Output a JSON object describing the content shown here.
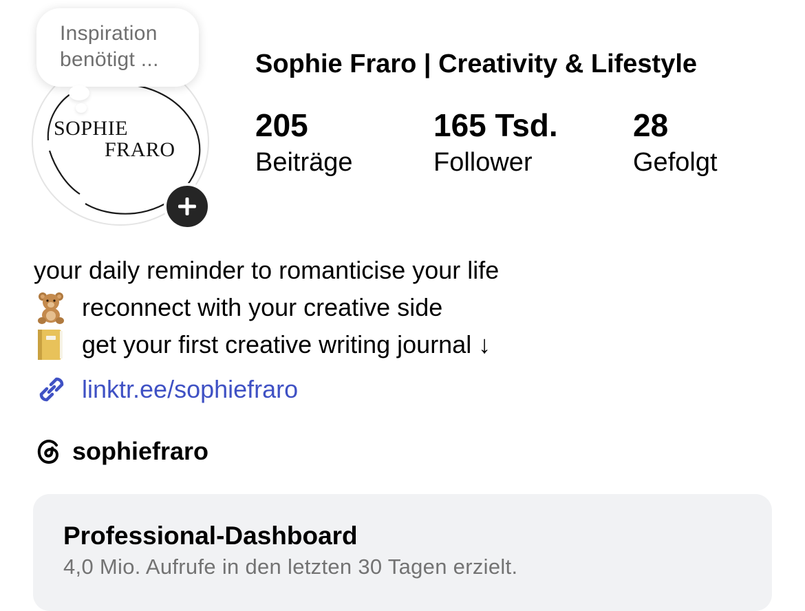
{
  "profile": {
    "display_name": "Sophie Fraro | Creativity & Lifestyle",
    "note": "Inspiration benötigt ...",
    "avatar_logo_line1": "SOPHIE",
    "avatar_logo_line2": "FRARO"
  },
  "stats": [
    {
      "value": "205",
      "label": "Beiträge"
    },
    {
      "value": "165 Tsd.",
      "label": "Follower"
    },
    {
      "value": "28",
      "label": "Gefolgt"
    }
  ],
  "bio": {
    "line1": "your daily reminder to romanticise your life",
    "line2": "reconnect with your creative side",
    "line3": "get your first creative writing journal ↓",
    "line2_icon": "teddy-bear-icon",
    "line3_icon": "notebook-icon"
  },
  "link": {
    "text": "linktr.ee/sophiefraro",
    "icon": "link-icon",
    "color": "#3f51c4"
  },
  "threads": {
    "handle": "sophiefraro",
    "icon": "threads-icon"
  },
  "dashboard": {
    "title": "Professional-Dashboard",
    "subtitle": "4,0 Mio. Aufrufe in den letzten 30 Tagen erzielt."
  },
  "colors": {
    "add_button": "#252525",
    "dashboard_bg": "#f1f2f4",
    "muted_text": "#737373"
  }
}
